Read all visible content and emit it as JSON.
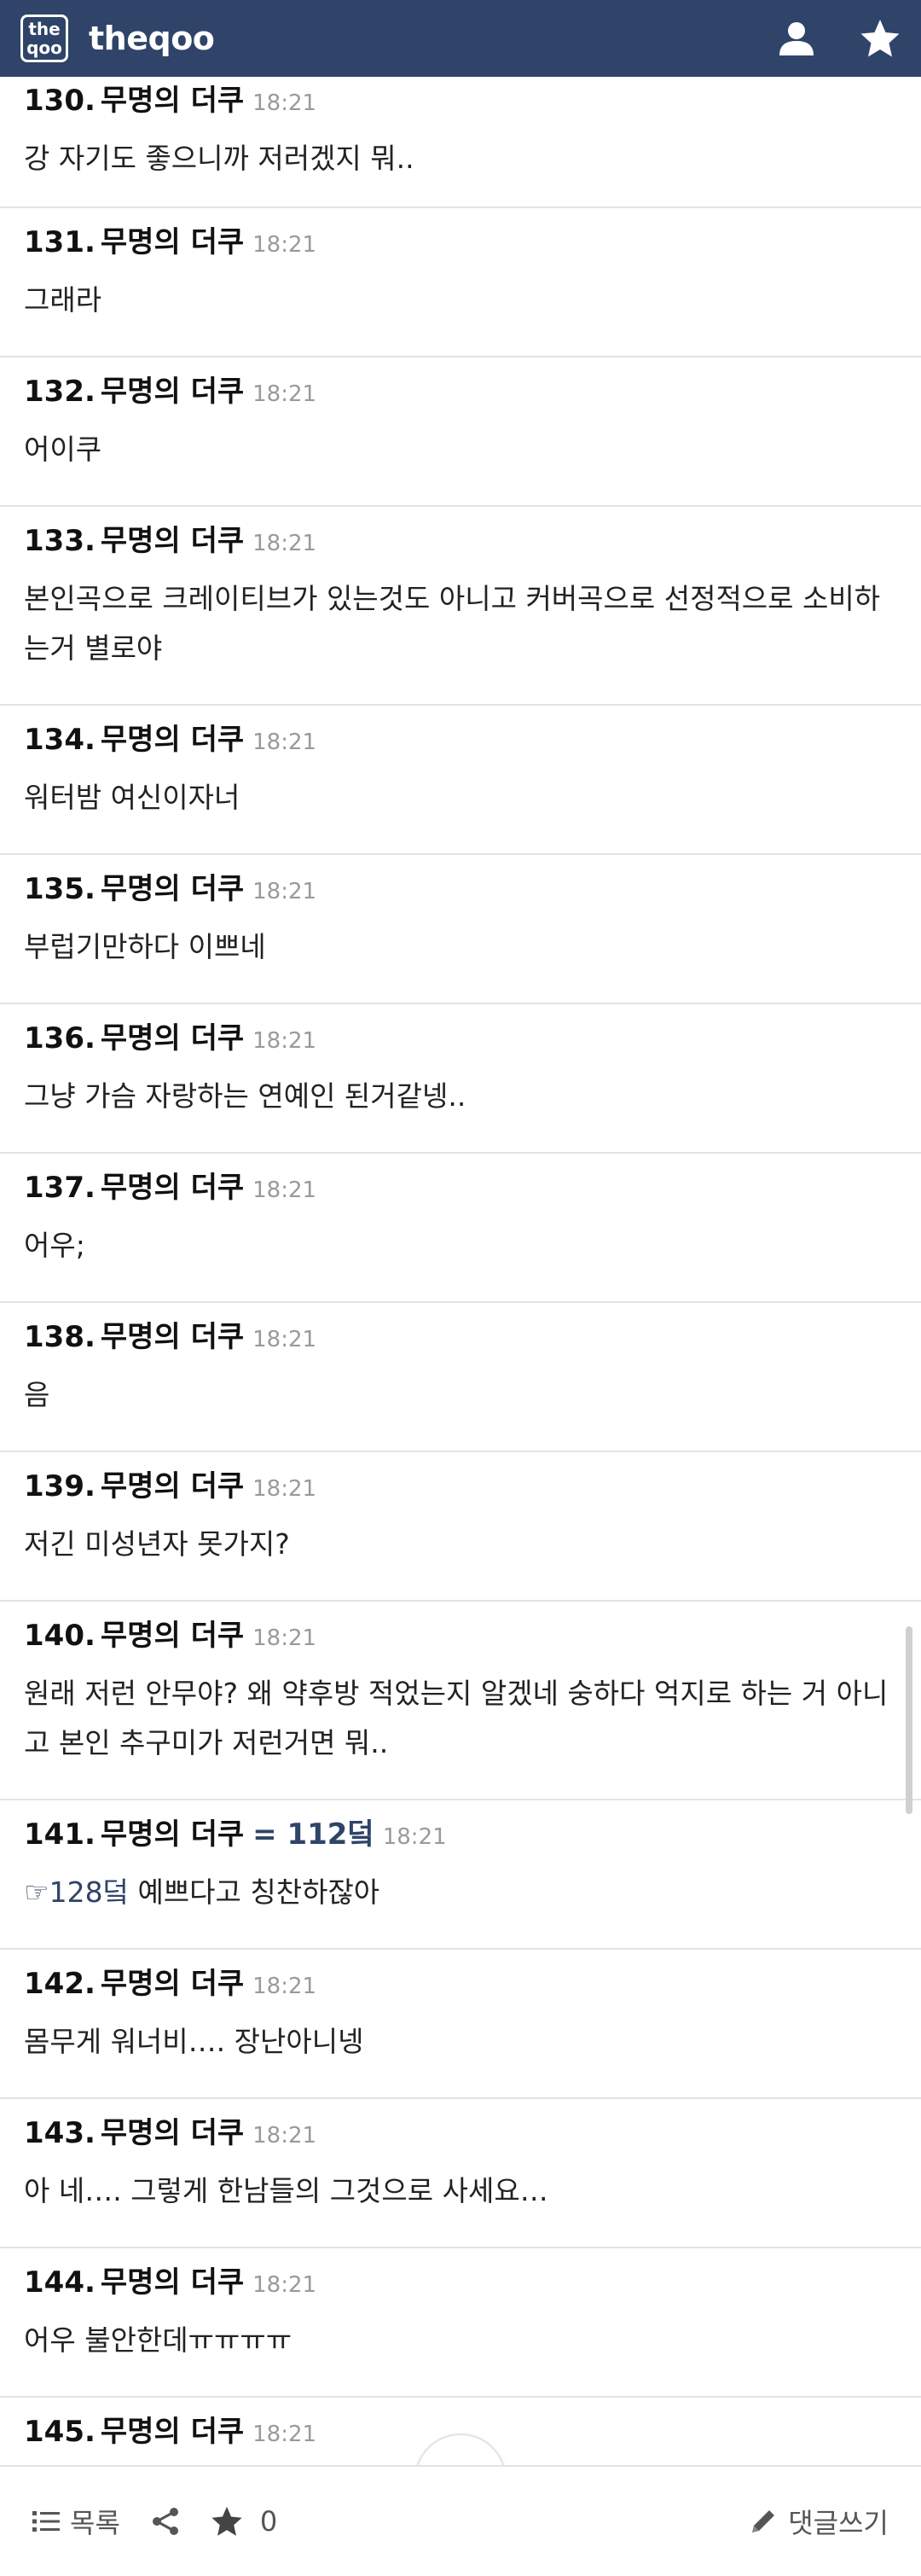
{
  "header": {
    "logo_top": "the",
    "logo_bottom": "qoo",
    "brand": "theqoo"
  },
  "comments": [
    {
      "num": "130.",
      "author": "무명의 더쿠",
      "reply": "",
      "time": "18:21",
      "link": "",
      "text": "강 자기도 좋으니까 저러겠지 뭐.."
    },
    {
      "num": "131.",
      "author": "무명의 더쿠",
      "reply": "",
      "time": "18:21",
      "link": "",
      "text": "그래라"
    },
    {
      "num": "132.",
      "author": "무명의 더쿠",
      "reply": "",
      "time": "18:21",
      "link": "",
      "text": "어이쿠"
    },
    {
      "num": "133.",
      "author": "무명의 더쿠",
      "reply": "",
      "time": "18:21",
      "link": "",
      "text": "본인곡으로 크레이티브가 있는것도 아니고 커버곡으로 선정적으로 소비하는거 별로야"
    },
    {
      "num": "134.",
      "author": "무명의 더쿠",
      "reply": "",
      "time": "18:21",
      "link": "",
      "text": "워터밤 여신이자너"
    },
    {
      "num": "135.",
      "author": "무명의 더쿠",
      "reply": "",
      "time": "18:21",
      "link": "",
      "text": "부럽기만하다 이쁘네"
    },
    {
      "num": "136.",
      "author": "무명의 더쿠",
      "reply": "",
      "time": "18:21",
      "link": "",
      "text": "그냥 가슴 자랑하는 연예인 된거같넹.."
    },
    {
      "num": "137.",
      "author": "무명의 더쿠",
      "reply": "",
      "time": "18:21",
      "link": "",
      "text": "어우;"
    },
    {
      "num": "138.",
      "author": "무명의 더쿠",
      "reply": "",
      "time": "18:21",
      "link": "",
      "text": "음"
    },
    {
      "num": "139.",
      "author": "무명의 더쿠",
      "reply": "",
      "time": "18:21",
      "link": "",
      "text": "저긴 미성년자 못가지?"
    },
    {
      "num": "140.",
      "author": "무명의 더쿠",
      "reply": "",
      "time": "18:21",
      "link": "",
      "text": "원래 저런 안무야? 왜 약후방 적었는지 알겠네 숭하다 억지로 하는 거 아니고 본인 추구미가 저런거면 뭐.."
    },
    {
      "num": "141.",
      "author": "무명의 더쿠",
      "reply": "= 112덬",
      "time": "18:21",
      "link": "☞128덬",
      "text": "예쁘다고 칭찬하잖아"
    },
    {
      "num": "142.",
      "author": "무명의 더쿠",
      "reply": "",
      "time": "18:21",
      "link": "",
      "text": "몸무게 워너비…. 장난아니넹"
    },
    {
      "num": "143.",
      "author": "무명의 더쿠",
      "reply": "",
      "time": "18:21",
      "link": "",
      "text": "아 네…. 그렇게 한남들의 그것으로 사세요…"
    },
    {
      "num": "144.",
      "author": "무명의 더쿠",
      "reply": "",
      "time": "18:21",
      "link": "",
      "text": "어우 불안한데ㅠㅠㅠㅠ"
    },
    {
      "num": "145.",
      "author": "무명의 더쿠",
      "reply": "",
      "time": "18:21",
      "link": "",
      "text": ""
    }
  ],
  "footer": {
    "list_label": "목록",
    "star_count": "0",
    "write_label": "댓글쓰기"
  }
}
